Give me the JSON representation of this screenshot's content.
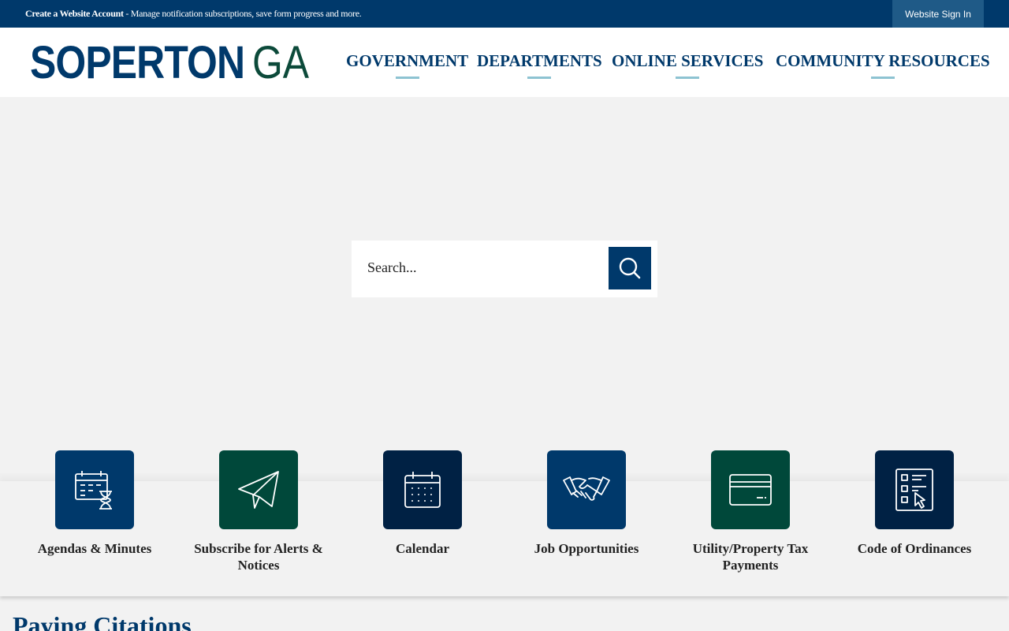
{
  "topbar": {
    "account_link": "Create a Website Account",
    "account_desc": " - Manage notification subscriptions, save form progress and more.",
    "signin_label": "Website Sign In"
  },
  "header": {
    "logo_main": "SOPERTON",
    "logo_ga": "GA",
    "nav": [
      "GOVERNMENT",
      "DEPARTMENTS",
      "ONLINE SERVICES",
      "COMMUNITY RESOURCES"
    ]
  },
  "search": {
    "placeholder": "Search...",
    "button_icon": "search-icon"
  },
  "quick_links": [
    {
      "label": "Agendas & Minutes",
      "icon": "calendar-hourglass-icon",
      "color": "#00396b"
    },
    {
      "label": "Subscribe for Alerts & Notices",
      "icon": "paper-plane-icon",
      "color": "#00483a"
    },
    {
      "label": "Calendar",
      "icon": "calendar-icon",
      "color": "#002144"
    },
    {
      "label": "Job Opportunities",
      "icon": "handshake-icon",
      "color": "#00396b"
    },
    {
      "label": "Utility/Property Tax Payments",
      "icon": "credit-card-icon",
      "color": "#00483a"
    },
    {
      "label": "Code of Ordinances",
      "icon": "checklist-icon",
      "color": "#002144"
    }
  ],
  "section": {
    "title": "Paying Citations"
  }
}
